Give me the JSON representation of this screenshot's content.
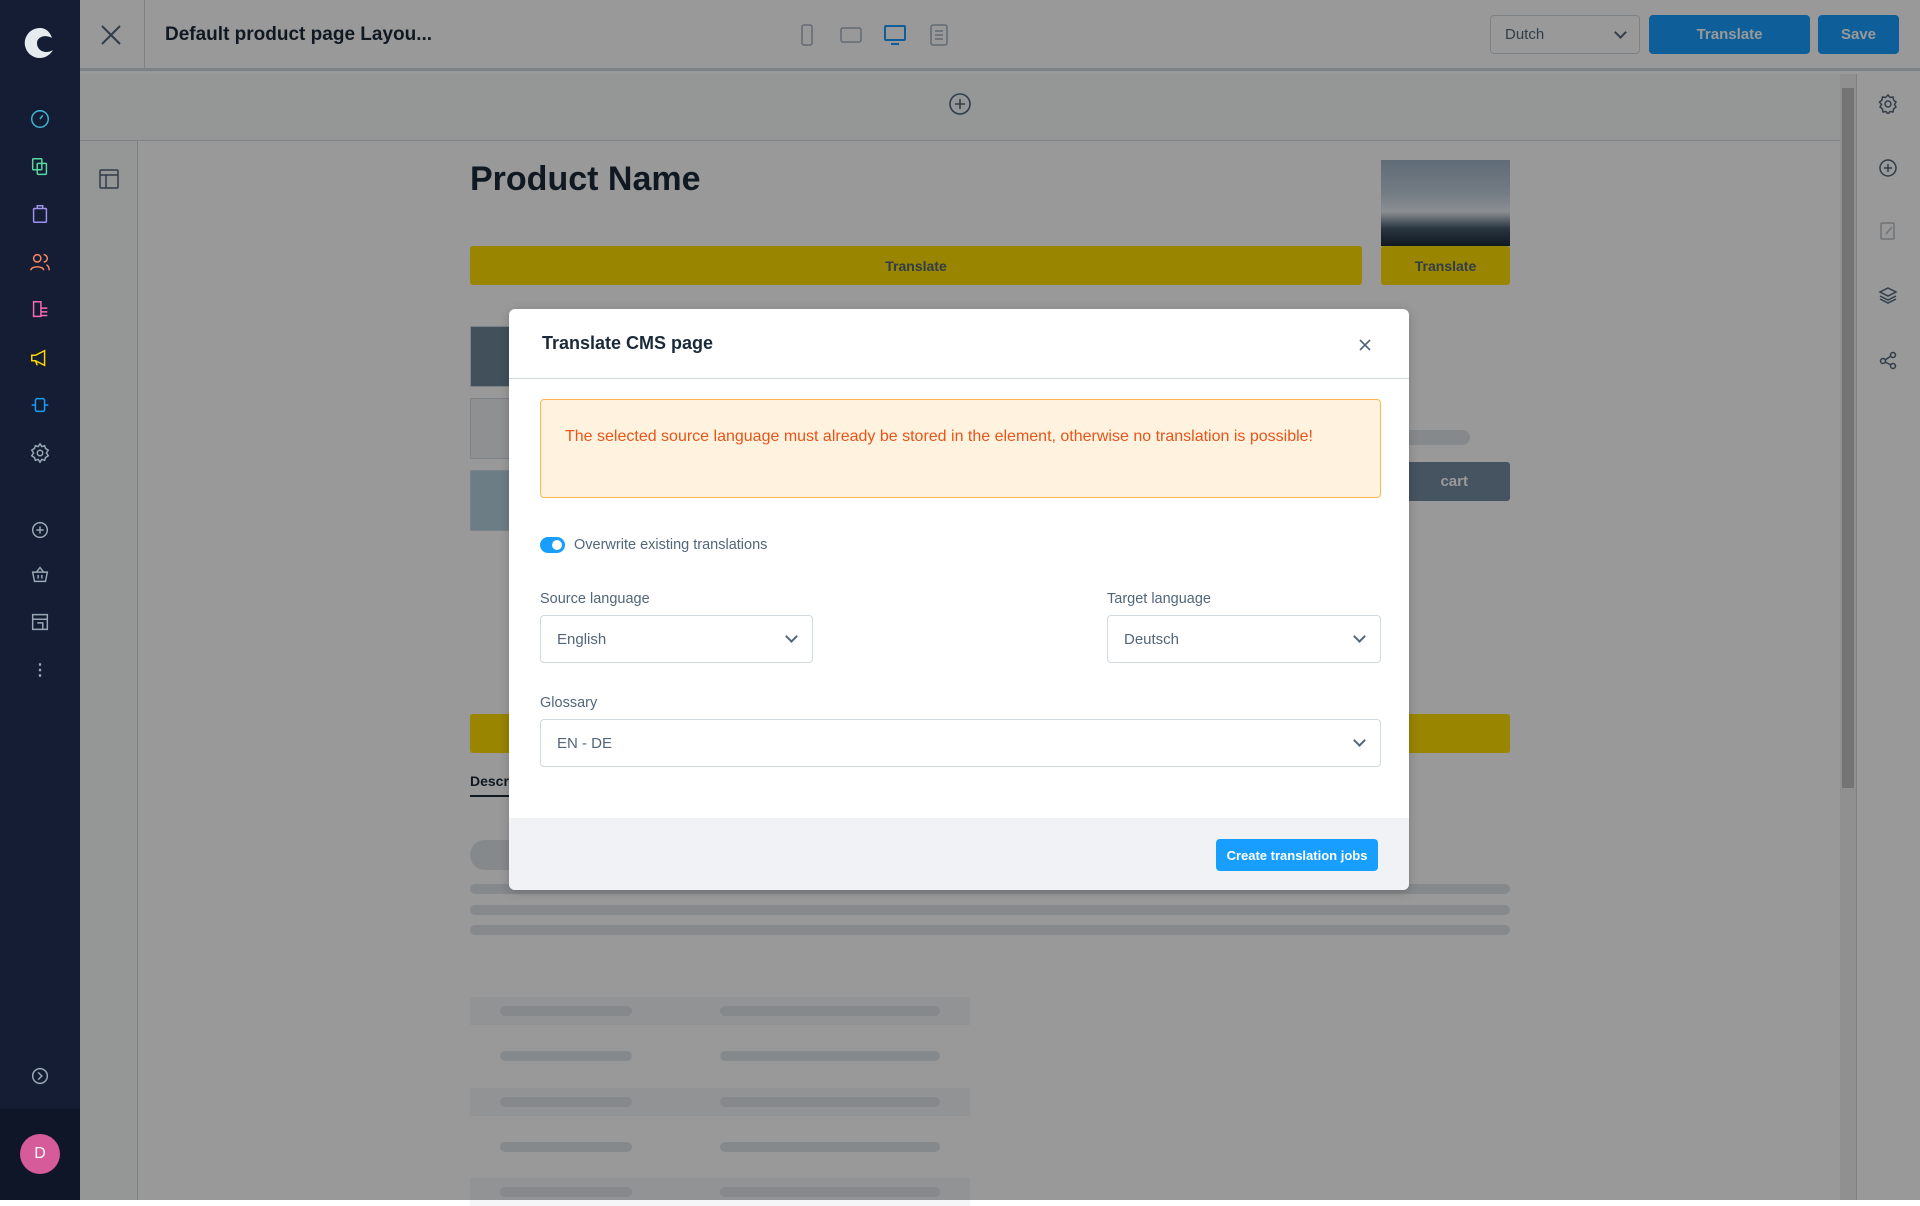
{
  "header": {
    "title": "Default product page Layou...",
    "language_select": "Dutch",
    "translate_label": "Translate",
    "save_label": "Save"
  },
  "canvas": {
    "product_name": "Product Name",
    "translate_label": "Translate",
    "image_translate_label": "Translate",
    "cart_label": "cart",
    "tab_label": "Descr"
  },
  "modal": {
    "title": "Translate CMS page",
    "alert": "The selected source language must already be stored in the element, otherwise no translation is possible!",
    "overwrite_label": "Overwrite existing translations",
    "overwrite_enabled": true,
    "source_label": "Source language",
    "source_value": "English",
    "target_label": "Target language",
    "target_value": "Deutsch",
    "glossary_label": "Glossary",
    "glossary_value": "EN - DE",
    "submit_label": "Create translation jobs"
  },
  "user": {
    "avatar_initial": "D"
  },
  "colors": {
    "primary": "#189eff",
    "sidebar": "#141d33",
    "warning_bg": "#fff3e0",
    "warning_text": "#e6551a",
    "highlight": "#ffde00"
  }
}
